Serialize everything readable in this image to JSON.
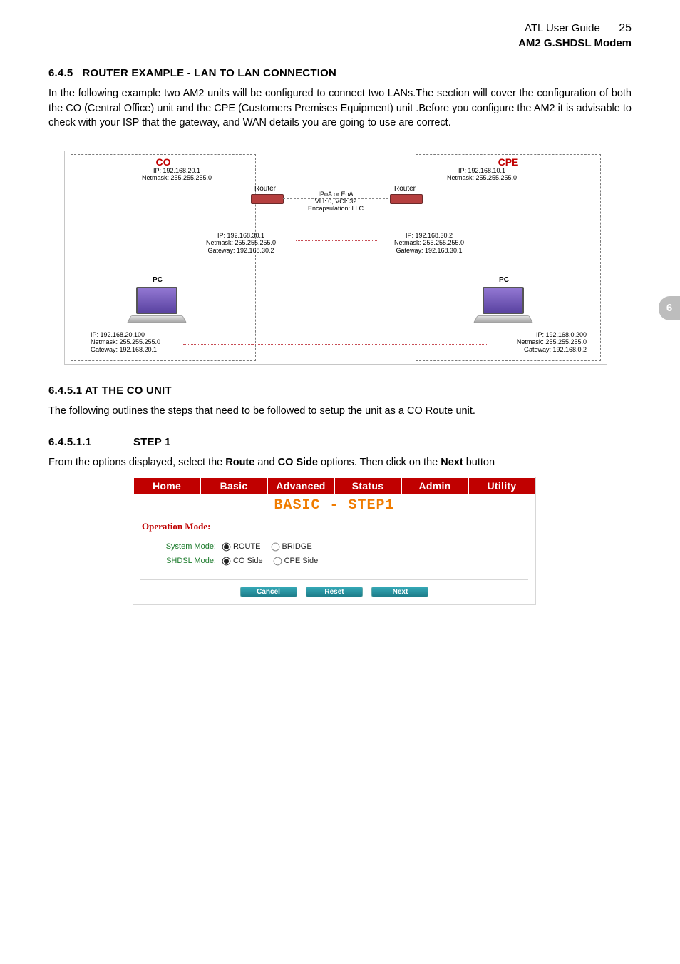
{
  "header": {
    "title": "ATL User Guide",
    "page": "25",
    "subtitle": "AM2 G.SHDSL Modem"
  },
  "side_tab": "6",
  "sec_645": {
    "num": "6.4.5",
    "title": "ROUTER EXAMPLE - LAN TO LAN CONNECTION",
    "p1": "In the following example two AM2 units will be configured to connect two LANs.The section will cover the configuration of both the CO (Central Office) unit and the CPE (Customers Premises Equipment) unit .Before you configure the AM2 it is advisable to check with your ISP that the gateway, and WAN details  you are going to use are correct."
  },
  "diagram": {
    "co_title": "CO",
    "cpe_title": "CPE",
    "co_lan": {
      "ip": "IP: 192.168.20.1",
      "mask": "Netmask: 255.255.255.0"
    },
    "cpe_lan": {
      "ip": "IP: 192.168.10.1",
      "mask": "Netmask: 255.255.255.0"
    },
    "router_label_left": "Router",
    "router_label_right": "Router",
    "link": {
      "l1": "IPoA or EoA",
      "l2": "VLI: 0, VCI: 32",
      "l3": "Encapsulation: LLC"
    },
    "co_wan": {
      "ip": "IP: 192.168.30.1",
      "mask": "Netmask: 255.255.255.0",
      "gw": "Gateway: 192.168.30.2"
    },
    "cpe_wan": {
      "ip": "IP: 192.168.30.2",
      "mask": "Netmask: 255.255.255.0",
      "gw": "Gateway: 192.168.30.1"
    },
    "pc_label": "PC",
    "co_pc": {
      "ip": "IP: 192.168.20.100",
      "mask": "Netmask: 255.255.255.0",
      "gw": "Gateway: 192.168.20.1"
    },
    "cpe_pc": {
      "ip": "IP: 192.168.0.200",
      "mask": "Netmask: 255.255.255.0",
      "gw": "Gateway: 192.168.0.2"
    }
  },
  "sec_6451": {
    "num_title": "6.4.5.1 AT THE CO UNIT",
    "p1": "The following outlines the steps that need to be followed to setup the unit as a CO Route unit."
  },
  "sec_64511": {
    "num": "6.4.5.1.1",
    "title": "STEP 1",
    "p_pre": "From the options displayed, select the ",
    "b1": "Route",
    "mid1": " and ",
    "b2": "CO Side",
    "mid2": " options. Then click on the ",
    "b3": "Next",
    "post": " button"
  },
  "shot": {
    "tabs": [
      "Home",
      "Basic",
      "Advanced",
      "Status",
      "Admin",
      "Utility"
    ],
    "title": "BASIC - STEP1",
    "op_mode": "Operation Mode:",
    "rows": {
      "system_label": "System Mode:",
      "system_opts": [
        "ROUTE",
        "BRIDGE"
      ],
      "system_selected": 0,
      "shdsl_label": "SHDSL Mode:",
      "shdsl_opts": [
        "CO Side",
        "CPE Side"
      ],
      "shdsl_selected": 0
    },
    "buttons": [
      "Cancel",
      "Reset",
      "Next"
    ]
  }
}
